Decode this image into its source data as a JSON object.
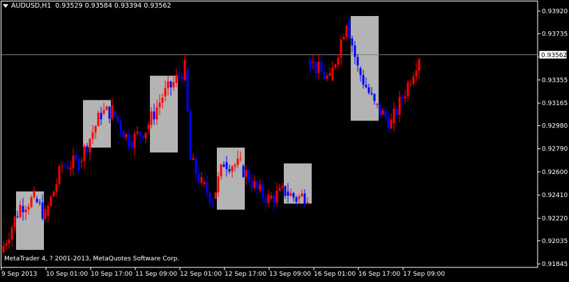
{
  "header": {
    "symbol_timeframe": "AUDUSD,H1",
    "ohlc": "0.93529 0.93584 0.93394 0.93562"
  },
  "copyright": "MetaTrader 4, ? 2001-2013, MetaQuotes Software Corp.",
  "colors": {
    "background": "#000000",
    "bull": "#ff0000",
    "bear": "#0000ff",
    "axis": "#ffffff",
    "box": "#b4b4b4",
    "price_line": "#808080"
  },
  "chart_data": {
    "type": "candlestick",
    "ylim": [
      0.91845,
      0.9392
    ],
    "y_ticks": [
      "0.93920",
      "0.93735",
      "0.93545",
      "0.93355",
      "0.93165",
      "0.92980",
      "0.92790",
      "0.92600",
      "0.92410",
      "0.92220",
      "0.92035",
      "0.91845"
    ],
    "x_ticks": [
      "9 Sep 2013",
      "10 Sep 01:00",
      "10 Sep 17:00",
      "11 Sep 09:00",
      "12 Sep 01:00",
      "12 Sep 17:00",
      "13 Sep 09:00",
      "16 Sep 01:00",
      "16 Sep 17:00",
      "17 Sep 09:00"
    ],
    "current_price": "0.93562",
    "current_price_value": 0.93562,
    "highlight_boxes": [
      {
        "bars": [
          5,
          14
        ],
        "high": 0.9244,
        "low": 0.9196
      },
      {
        "bars": [
          29,
          38
        ],
        "high": 0.9319,
        "low": 0.928
      },
      {
        "bars": [
          53,
          62
        ],
        "high": 0.9339,
        "low": 0.9276
      },
      {
        "bars": [
          77,
          86
        ],
        "high": 0.928,
        "low": 0.9229
      },
      {
        "bars": [
          101,
          110
        ],
        "high": 0.9267,
        "low": 0.9234
      },
      {
        "bars": [
          125,
          134
        ],
        "high": 0.9388,
        "low": 0.9302
      }
    ],
    "segments": [
      {
        "from": 0,
        "to": 7,
        "open": 0.9194,
        "close": 0.9232
      },
      {
        "from": 7,
        "to": 12,
        "open": 0.9232,
        "close": 0.9238
      },
      {
        "from": 12,
        "to": 16,
        "open": 0.9238,
        "close": 0.9224
      },
      {
        "from": 16,
        "to": 22,
        "open": 0.9224,
        "close": 0.9265
      },
      {
        "from": 22,
        "to": 28,
        "open": 0.9265,
        "close": 0.9268
      },
      {
        "from": 28,
        "to": 36,
        "open": 0.9268,
        "close": 0.9308
      },
      {
        "from": 36,
        "to": 40,
        "open": 0.9308,
        "close": 0.931
      },
      {
        "from": 40,
        "to": 46,
        "open": 0.931,
        "close": 0.9285
      },
      {
        "from": 46,
        "to": 52,
        "open": 0.9285,
        "close": 0.9295
      },
      {
        "from": 52,
        "to": 58,
        "open": 0.9295,
        "close": 0.9322
      },
      {
        "from": 58,
        "to": 62,
        "open": 0.9322,
        "close": 0.9333
      },
      {
        "from": 62,
        "to": 66,
        "open": 0.9333,
        "close": 0.9345
      },
      {
        "from": 66,
        "to": 68,
        "open": 0.9345,
        "close": 0.927
      },
      {
        "from": 68,
        "to": 72,
        "open": 0.927,
        "close": 0.925
      },
      {
        "from": 72,
        "to": 76,
        "open": 0.925,
        "close": 0.9238
      },
      {
        "from": 76,
        "to": 80,
        "open": 0.9238,
        "close": 0.9268
      },
      {
        "from": 80,
        "to": 86,
        "open": 0.9268,
        "close": 0.9265
      },
      {
        "from": 86,
        "to": 92,
        "open": 0.9265,
        "close": 0.9245
      },
      {
        "from": 92,
        "to": 96,
        "open": 0.9245,
        "close": 0.9238
      },
      {
        "from": 96,
        "to": 102,
        "open": 0.9238,
        "close": 0.9244
      },
      {
        "from": 102,
        "to": 106,
        "open": 0.9244,
        "close": 0.9238
      },
      {
        "from": 106,
        "to": 110,
        "open": 0.9238,
        "close": 0.9242
      },
      {
        "from": 110,
        "to": 111,
        "open": 0.9352,
        "close": 0.935
      },
      {
        "from": 111,
        "to": 118,
        "open": 0.935,
        "close": 0.9335
      },
      {
        "from": 118,
        "to": 124,
        "open": 0.9335,
        "close": 0.9385
      },
      {
        "from": 124,
        "to": 128,
        "open": 0.9385,
        "close": 0.9345
      },
      {
        "from": 128,
        "to": 134,
        "open": 0.9345,
        "close": 0.9315
      },
      {
        "from": 134,
        "to": 140,
        "open": 0.9315,
        "close": 0.93
      },
      {
        "from": 140,
        "to": 146,
        "open": 0.93,
        "close": 0.9332
      },
      {
        "from": 146,
        "to": 150,
        "open": 0.9332,
        "close": 0.9356
      }
    ]
  }
}
